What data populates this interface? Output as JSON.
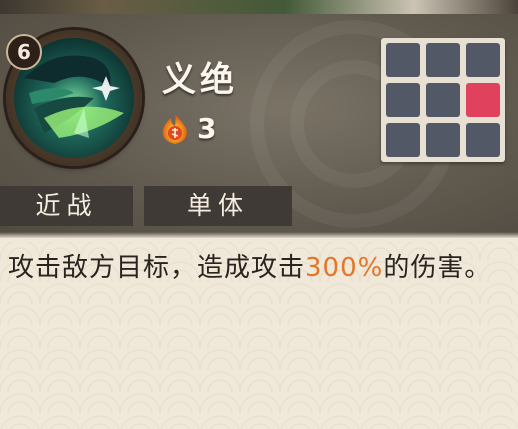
{
  "skill": {
    "level": "6",
    "name": "义绝",
    "cost": "3",
    "cost_icon": "fire-orb-icon",
    "portrait_icon": "skill-portrait-icon"
  },
  "tags": {
    "range": "近战",
    "target": "单体"
  },
  "area_grid": {
    "rows": 3,
    "cols": 3,
    "active_cells": [
      [
        1,
        2
      ]
    ],
    "active_color": "#e0425d",
    "inactive_color": "#535866"
  },
  "description": {
    "before": "攻击敌方目标，造成攻击",
    "highlight": "300%",
    "after": "的伤害。",
    "highlight_color": "#e2772a"
  }
}
